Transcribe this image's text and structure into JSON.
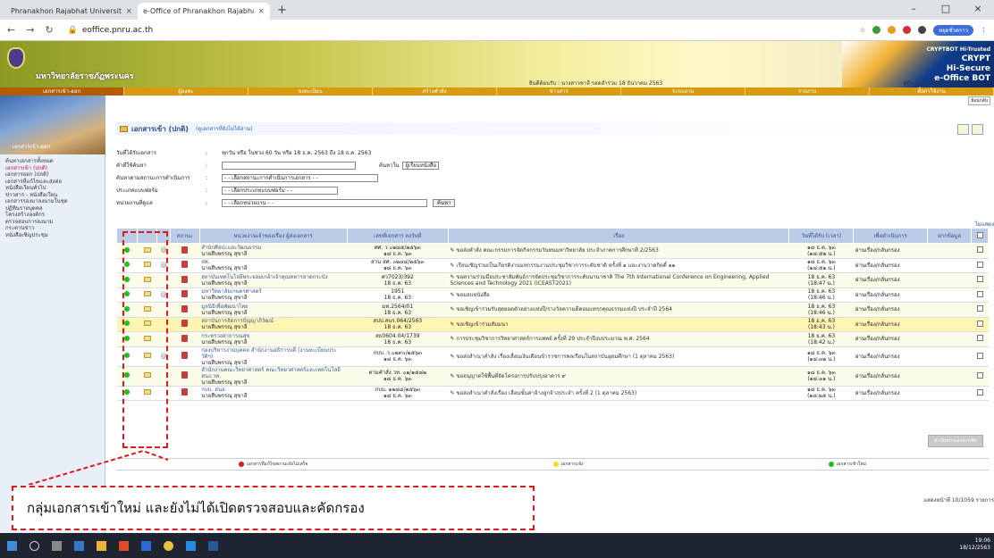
{
  "browser": {
    "tabs": [
      {
        "title": "Phranakhon Rajabhat University",
        "close": "×"
      },
      {
        "title": "e-Office of Phranakhon Rajabha",
        "close": "×"
      }
    ],
    "new_tab": "+",
    "url": "eoffice.pnru.ac.th",
    "profile": "หยุดชั่วคราว",
    "window_controls": [
      "–",
      "□",
      "×"
    ]
  },
  "banner": {
    "university": "มหาวิทยาลัยราชภัฏพระนคร",
    "crypt_top": "CRYPTBOT  Hi-Trusted",
    "crypt_mid": "CRYPT",
    "brand1": "Hi-Secure",
    "brand2": "e-Office BOT",
    "login_info": "ยินดีต้อนรับ : นางสาวชาลี รอดสำรวม  18 ธันวาคม 2563",
    "top_links": "คู่มือ  ค้นหา  ติดตามงาน  ออกจากระบบ"
  },
  "menu": [
    "เอกสารเข้า-ออก",
    "ผู้ลงทะ",
    "ลงทะเบียน",
    "สร้างคำสั่ง",
    "ข่าวสาร",
    "ระบบงาน",
    "รายงาน",
    "ตั้งค่าใช้งาน"
  ],
  "sidebar": {
    "caption": "เอกสารเข้า-ออก",
    "items": [
      "ค้นหาเอกสารทั้งหมด",
      "เอกสารเข้า (ปกติ)",
      "เอกสารออก (ปกติ)",
      "เอกสารที่แก้ไขและส่งต่อ",
      "หนังสือเวียนทั่วไป",
      "ข่าวสาร - หนังสือเวียน",
      "เอกสารรองมาลงนามในชุด",
      "ปฏิทินรายบุคคล",
      "โครงสร้างองค์กร",
      "ตรวจสอบการลงนาม",
      "กระดานข่าว",
      "หนังสือเชิญประชุม"
    ]
  },
  "page": {
    "breadcrumb": "ย้อนกลับ",
    "title": "เอกสารเข้า (ปกติ)",
    "subtitle": "(ดูเอกสารที่ยังไม่ได้อ่าน)",
    "hide_label": "ไม่แสดง"
  },
  "form": {
    "date_label": "วันที่ได้รับเอกสาร",
    "date_options": "ทุกวัน หรือ ในช่วง 60 วัน หรือ 18 ธ.ค. 2563 ถึง 18 ธ.ค. 2563",
    "keyword_label": "คำที่ใช้ค้นหา",
    "search_in": "ค้นหาใน",
    "search_field": "ผู้เรียนหนังสือ",
    "status_label": "ค้นหาตามสถานะการดำเนินการ",
    "status_value": "- - เลือกสถานะการดำเนินการเอกสาร - -",
    "type_label": "ประเภทแบบฟอร์ม",
    "type_value": "- - เลือกประเภทแบบฟอร์ม - -",
    "unit_label": "หน่วยงานที่ดูแล",
    "unit_value": "- - เลือกหน่วยงาน - -",
    "search_btn": "ค้นหา"
  },
  "table": {
    "headers": [
      "",
      "",
      "",
      "สถานะ",
      "หน่วยงานเจ้าของเรื่อง\nผู้ส่งเอกสาร",
      "เลขที่เอกสาร\nลงวันที่",
      "เรื่อง",
      "วันที่ได้รับ\n(เวลา)",
      "เพื่อดำเนินการ",
      "ฝากข้อมูล",
      ""
    ],
    "rows": [
      {
        "org": "สำนักศิลปะและวัฒนธรรม",
        "sender": "นายสืบพรรณุ สุขาลี",
        "docno": "ศศ. ว ๐๒๘๕/๒๕๖๓",
        "docdate": "๑๘ ธ.ค. ๖๓",
        "subject": "ขอส่งคำสั่ง คณะกรรมการจัดกิจกรรมวันทนมหาวิทยาลัย ประจำภาคการศึกษาที่ 2/2563",
        "recv": "๑๘ ธ.ค. ๖๓",
        "time": "(๑๘:๕๒ น.)",
        "action": "ผ่านเรื่อง/กลั่นกรอง",
        "attach": true,
        "pdf": true,
        "style": "grn"
      },
      {
        "org": "สศ.",
        "sender": "นายสืบพรรณุ สุขาลี",
        "docno": "สวน สศ. ๐๒๘๔/๒๕๖๓",
        "docdate": "๑๘ ธ.ค. ๖๓",
        "subject": "เรียนเชิญร่วมเป็นเกียรติงานมหกรรมงานประชุมวิชาการระดับชาติ ครั้งที่ ๑ และงานวาดกิตติ์ ๑๑",
        "recv": "๑๘ ธ.ค. ๖๓",
        "time": "(๑๘:๕๑ น.)",
        "action": "ผ่านเรื่อง/กลั่นกรอง",
        "attach": true,
        "pdf": true,
        "style": ""
      },
      {
        "org": "สถาบันเทคโนโลยีพระจอมเกล้าเจ้าคุณทหารลาดกระบัง",
        "sender": "นายสืบพรรณุ สุขาลี",
        "docno": "ศว7023/392",
        "docdate": "18 ธ.ค. 63",
        "subject": "ขอความร่วมมือประชาสัมพันธ์การจัดประชุมวิชาการระดับนานาชาติ The 7th International Conference on Engineering, Applied Sciences and Technology 2021 (ICEAST2021)",
        "recv": "18 ธ.ค. 63",
        "time": "(18:47 น.)",
        "action": "ผ่านเรื่อง/กลั่นกรอง",
        "attach": false,
        "pdf": true,
        "style": "grn"
      },
      {
        "org": "มหาวิทยาลัยเกษตรศาสตร์",
        "sender": "นายสืบพรรณุ สุขาลี",
        "docno": "1951",
        "docdate": "18 ธ.ค. 63",
        "subject": "ขอมอบหนังสือ",
        "recv": "18 ธ.ค. 63",
        "time": "(18:46 น.)",
        "action": "ผ่านเรื่อง/กลั่นกรอง",
        "attach": true,
        "pdf": true,
        "style": ""
      },
      {
        "org": "มูลนิธิเพื่อพัฒนาไทย",
        "sender": "นายสืบพรรณุ สุขาลี",
        "docno": "มท.2564/01",
        "docdate": "18 ธ.ค. 63",
        "subject": "ขอเชิญเข้าร่วมรับสุดยอดตัวอย่างแห่งปี/รางวัลความดีคอมแทรกคุณธรรมแห่งปี ประจำปี 2564",
        "recv": "18 ธ.ค. 63",
        "time": "(18:46 น.)",
        "action": "ผ่านเรื่อง/กลั่นกรอง",
        "attach": false,
        "pdf": true,
        "style": "grn"
      },
      {
        "org": "สถาบันการจัดการปัญญาภิวัฒน์",
        "sender": "นายสืบพรรณุ สุขาลี",
        "docno": "สปป.สนร.064/2563",
        "docdate": "18 ธ.ค. 63",
        "subject": "ขอเชิญเข้าร่วมสัมมนา",
        "recv": "18 ธ.ค. 63",
        "time": "(18:43 น.)",
        "action": "ผ่านเรื่อง/กลั่นกรอง",
        "attach": false,
        "pdf": true,
        "style": "yel"
      },
      {
        "org": "กระทรวงสาธารณสุข",
        "sender": "นายสืบพรรณุ สุขาลี",
        "docno": "สธ0604.04/1739",
        "docdate": "18 ธ.ค. 63",
        "subject": "การประชุมวิชาการวิทยาศาสตร์การแพทย์ ครั้งที่ 29 ประจำปีงบประมาณ พ.ศ. 2564",
        "recv": "18 ธ.ค. 63",
        "time": "(18:42 น.)",
        "action": "ผ่านเรื่อง/กลั่นกรอง",
        "attach": false,
        "pdf": true,
        "style": "grn"
      },
      {
        "org": "กองบริหารงานบุคคล สำนักงานอธิการบดี (งานทะเบียนประวัติฯ)",
        "sender": "นายสืบพรรณุ สุขาลี",
        "docno": "กบบ. ว ๐๒๙๐/๒๕๖๓",
        "docdate": "๑๘ ธ.ค. ๖๓",
        "subject": "ขอส่งสำเนาคำสั่ง เรื่องเลื่อนเงินเดือนข้าราชการพลเรือนในสถาบันอุดมศึกษา (1 ตุลาคม 2563)",
        "recv": "๑๘ ธ.ค. ๖๓",
        "time": "(๑๘:๓๒ น.)",
        "action": "ผ่านเรื่อง/กลั่นกรอง",
        "attach": true,
        "pdf": true,
        "style": ""
      },
      {
        "org": "สำนักงานคณะวิทยาศาสตร์ คณะวิทยาศาสตร์และเทคโนโลยี สนง.วท.",
        "sender": "นายสืบพรรณุ สุขาลี",
        "docno": "ตามคำสั่ง วท. ๐๑/๑๕๘๒",
        "docdate": "๑๘ ธ.ค. ๖๓",
        "subject": "ขออนุญาตใช้พื้นที่จัดโครงการปรับปรุงอาคาร ๙",
        "recv": "๑๘ ธ.ค. ๖๓",
        "time": "(๑๘:๓๑ น.)",
        "action": "ผ่านเรื่อง/กลั่นกรอง",
        "attach": false,
        "pdf": true,
        "style": "grn"
      },
      {
        "org": "กบบ. สนอ.",
        "sender": "นายสืบพรรณุ สุขาลี",
        "docno": "กบบ. ๑๒๘๔/๒๕๖๓",
        "docdate": "๑๘ ธ.ค. ๖๓",
        "subject": "ขอส่งสำเนาคำสั่งเรื่อง เลื่อนขั้นค่าจ้างลูกจ้างประจำ ครั้งที่ 2 (1 ตุลาคม 2563)",
        "recv": "๑๘ ธ.ค. ๖๓",
        "time": "(๑๘:๒๕ น.)",
        "action": "ผ่านเรื่อง/กลั่นกรอง",
        "attach": false,
        "pdf": true,
        "style": ""
      }
    ]
  },
  "action_button": "ดำเนินการเอกสารเพิ่ม",
  "legend": [
    {
      "label": "เอกสารที่แก้ไขสถานะยังไม่เสร็จ",
      "color": "#e01818"
    },
    {
      "label": "เอกสารแจ้ง",
      "color": "#e8e02a"
    },
    {
      "label": "เอกสารเข้าใหม่",
      "color": "#19c11c"
    }
  ],
  "page_info": "แสดงหน้าที่ 10/1059 รายการ",
  "callout_text": "กลุ่มเอกสารเข้าใหม่ และยังไม่ได้เปิดตรวจสอบและคัดกรอง",
  "taskbar": {
    "time": "19:06",
    "date": "18/12/2563"
  }
}
